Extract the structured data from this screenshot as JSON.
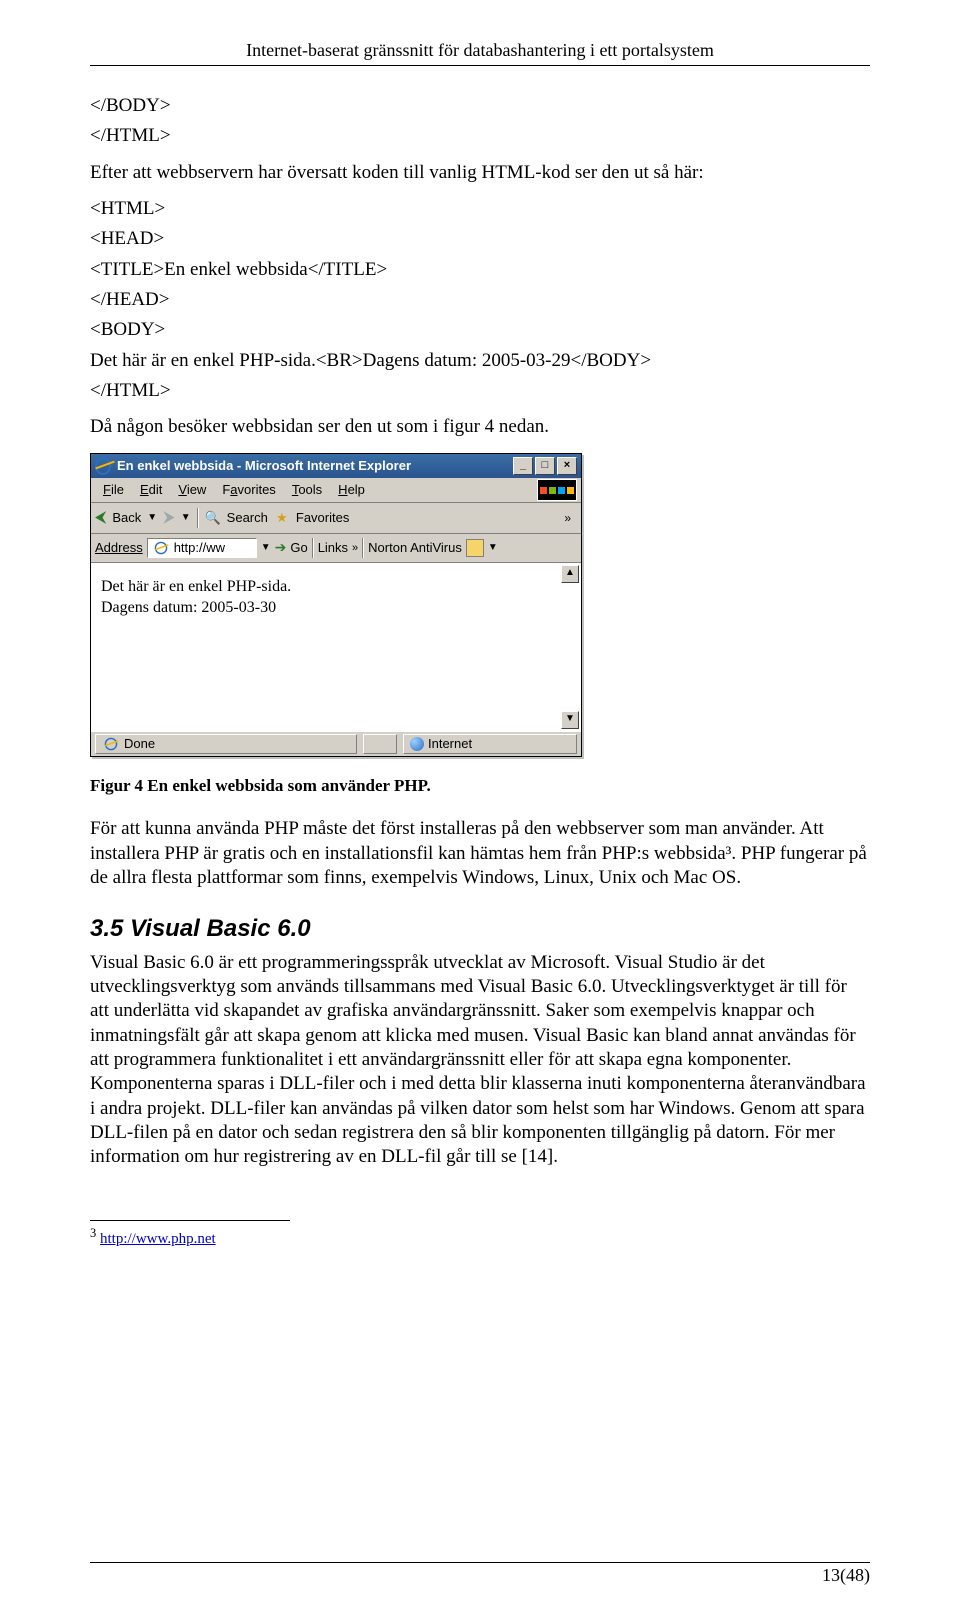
{
  "head": {
    "running": "Internet-baserat gränssnitt för databashantering i ett portalsystem"
  },
  "body": {
    "code1_l1": "</BODY>",
    "code1_l2": "</HTML>",
    "p1": "Efter att webbservern har översatt koden till vanlig HTML-kod ser den ut så här:",
    "code2_l1": "<HTML>",
    "code2_l2": "<HEAD>",
    "code2_l3": "<TITLE>En enkel webbsida</TITLE>",
    "code2_l4": "</HEAD>",
    "code2_l5": "<BODY>",
    "code2_l6": "Det här är en enkel PHP-sida.<BR>Dagens datum: 2005-03-29</BODY>",
    "code2_l7": "</HTML>",
    "p2": "Då någon besöker webbsidan ser den ut som i figur 4 nedan.",
    "fig_caption": "Figur 4 En enkel webbsida som använder PHP.",
    "p3": "För att kunna använda PHP måste det först installeras på den webbserver som man använder. Att installera PHP är gratis och en installationsfil kan hämtas hem från PHP:s webbsida³. PHP fungerar på de allra flesta plattformar som finns, exempelvis Windows, Linux, Unix och Mac OS.",
    "sec_heading": "3.5  Visual Basic 6.0",
    "p4": "Visual Basic 6.0 är ett programmeringsspråk utvecklat av Microsoft. Visual Studio är det utvecklingsverktyg som används tillsammans med Visual Basic 6.0. Utvecklingsverktyget är till för att underlätta vid skapandet av grafiska användargränssnitt. Saker som exempelvis knappar och inmatningsfält går att skapa genom att klicka med musen. Visual Basic kan bland annat användas för att programmera funktionalitet i ett användargränssnitt eller för att skapa egna komponenter. Komponenterna sparas i DLL-filer och i med detta blir klasserna inuti komponenterna återanvändbara i andra projekt. DLL-filer kan användas på vilken dator som helst som har Windows. Genom att spara DLL-filen på en dator och sedan registrera den så blir komponenten tillgänglig på datorn.  För mer information om hur registrering av en DLL-fil går till se [14].",
    "fn_num": "3",
    "fn_url": "http://www.php.net",
    "page_num": "13(48)"
  },
  "ie": {
    "title": "En enkel webbsida - Microsoft Internet Explorer",
    "menu": {
      "file": "File",
      "edit": "Edit",
      "view": "View",
      "favorites": "Favorites",
      "tools": "Tools",
      "help": "Help"
    },
    "toolbar": {
      "back": "Back",
      "search": "Search",
      "favorites": "Favorites"
    },
    "addr": {
      "label": "Address",
      "value": "http://ww",
      "go": "Go",
      "links": "Links",
      "norton": "Norton AntiVirus"
    },
    "content_l1": "Det här är en enkel PHP-sida.",
    "content_l2": "Dagens datum: 2005-03-30",
    "status": {
      "done": "Done",
      "zone": "Internet"
    }
  }
}
